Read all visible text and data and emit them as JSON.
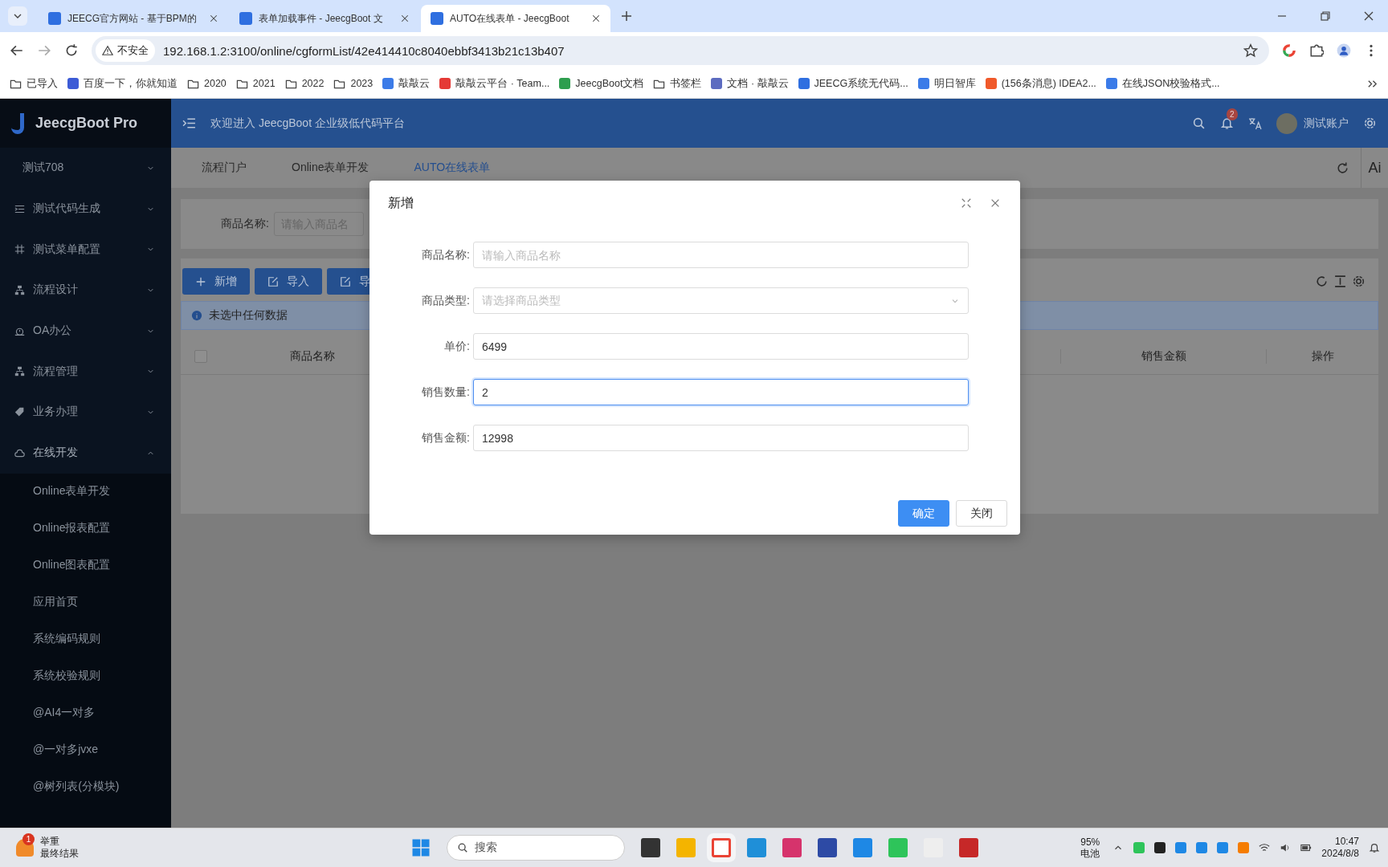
{
  "browser": {
    "tabs": [
      {
        "title": "JEECG官方网站 - 基于BPM的",
        "selected": false
      },
      {
        "title": "表单加载事件 - JeecgBoot 文",
        "selected": false
      },
      {
        "title": "AUTO在线表单 - JeecgBoot",
        "selected": true
      }
    ],
    "security": "不安全",
    "url": "192.168.1.2:3100/online/cgformList/42e414410c8040ebbf3413b21c13b407",
    "bookmarks": [
      {
        "label": "已导入",
        "kind": "folder"
      },
      {
        "label": "百度一下，你就知道",
        "kind": "site"
      },
      {
        "label": "2020",
        "kind": "folder"
      },
      {
        "label": "2021",
        "kind": "folder"
      },
      {
        "label": "2022",
        "kind": "folder"
      },
      {
        "label": "2023",
        "kind": "folder"
      },
      {
        "label": "敲敲云",
        "kind": "site"
      },
      {
        "label": "敲敲云平台 · Team...",
        "kind": "site"
      },
      {
        "label": "JeecgBoot文档",
        "kind": "site"
      },
      {
        "label": "书签栏",
        "kind": "folder"
      },
      {
        "label": "文档 · 敲敲云",
        "kind": "site"
      },
      {
        "label": "JEECG系统无代码...",
        "kind": "site"
      },
      {
        "label": "明日智库",
        "kind": "site"
      },
      {
        "label": "(156条消息) IDEA2...",
        "kind": "site"
      },
      {
        "label": "在线JSON校验格式...",
        "kind": "site"
      }
    ]
  },
  "app": {
    "brand": "JeecgBoot Pro",
    "sidebar": {
      "items": [
        {
          "label": "测试708",
          "expanded": false
        },
        {
          "label": "测试代码生成",
          "expanded": false
        },
        {
          "label": "测试菜单配置",
          "expanded": false
        },
        {
          "label": "流程设计",
          "expanded": false
        },
        {
          "label": "OA办公",
          "expanded": false
        },
        {
          "label": "流程管理",
          "expanded": false
        },
        {
          "label": "业务办理",
          "expanded": false
        },
        {
          "label": "在线开发",
          "expanded": true,
          "children": [
            {
              "label": "Online表单开发"
            },
            {
              "label": "Online报表配置"
            },
            {
              "label": "Online图表配置"
            },
            {
              "label": "应用首页"
            },
            {
              "label": "系统编码规则"
            },
            {
              "label": "系统校验规则"
            },
            {
              "label": "@AI4一对多"
            },
            {
              "label": "@一对多jvxe"
            },
            {
              "label": "@树列表(分模块)"
            }
          ]
        }
      ]
    },
    "header": {
      "welcome": "欢迎进入 JeecgBoot 企业级低代码平台",
      "notifications": "2",
      "user": "测试账户"
    },
    "page_tabs": [
      {
        "label": "流程门户",
        "selected": false
      },
      {
        "label": "Online表单开发",
        "selected": false
      },
      {
        "label": "AUTO在线表单",
        "selected": true
      }
    ],
    "ai_button": "Ai",
    "search": {
      "label": "商品名称:",
      "placeholder": "请输入商品名"
    },
    "toolbar": [
      "新增",
      "导入",
      "导"
    ],
    "alert": "未选中任何数据",
    "table": {
      "select_all_checked": false,
      "columns": [
        "商品名称",
        "销售金额",
        "操作"
      ]
    }
  },
  "modal": {
    "title": "新增",
    "fields": [
      {
        "label": "商品名称:",
        "kind": "text",
        "placeholder": "请输入商品名称",
        "focused": false
      },
      {
        "label": "商品类型:",
        "kind": "select",
        "placeholder": "请选择商品类型",
        "focused": false
      },
      {
        "label": "单价:",
        "kind": "text",
        "value": "6499",
        "focused": false
      },
      {
        "label": "销售数量:",
        "kind": "text",
        "value": "2",
        "focused": true
      },
      {
        "label": "销售金额:",
        "kind": "text",
        "value": "12998",
        "focused": false
      }
    ],
    "buttons": [
      {
        "label": "确定",
        "kind": "primary"
      },
      {
        "label": "关闭",
        "kind": "default"
      }
    ]
  },
  "taskbar": {
    "notification": {
      "badge": "1",
      "title": "举重",
      "subtitle": "最终结果"
    },
    "search": "搜索",
    "battery": "95%",
    "battery_label": "电池",
    "time": "10:47",
    "date": "2024/8/8"
  }
}
